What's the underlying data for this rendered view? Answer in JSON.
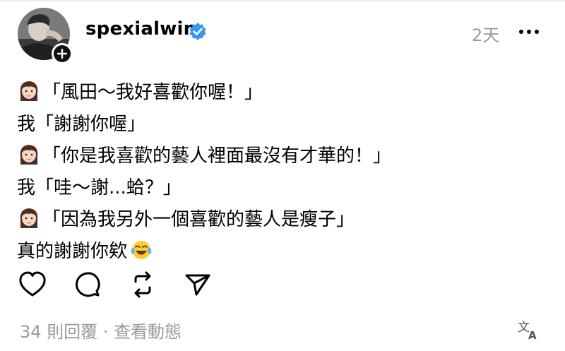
{
  "post": {
    "username": "spexialwin",
    "time": "2天",
    "lines": [
      {
        "speaker": "woman-emoji",
        "text": "「風田～我好喜歡你喔！」"
      },
      {
        "speaker": "",
        "text": "我「謝謝你喔」"
      },
      {
        "speaker": "woman-emoji",
        "text": "「你是我喜歡的藝人裡面最沒有才華的！」"
      },
      {
        "speaker": "",
        "text": "我「哇～謝...蛤？」"
      },
      {
        "speaker": "woman-emoji",
        "text": "「因為我另外一個喜歡的藝人是瘦子」"
      },
      {
        "speaker": "",
        "text": "真的謝謝你欸",
        "trailing_emoji": "tears-of-joy-emoji"
      }
    ]
  },
  "footer": {
    "replies": "34 則回覆",
    "separator": " · ",
    "activity": "查看動態"
  },
  "icons": {
    "like": "heart-icon",
    "reply": "comment-icon",
    "repost": "repost-icon",
    "share": "send-icon",
    "translate": "translate-icon",
    "verified": "verified-badge-icon",
    "more": "more-icon",
    "follow": "plus-icon"
  },
  "colors": {
    "verified": "#3897f0",
    "muted": "#9a9a9a",
    "text": "#000000"
  }
}
